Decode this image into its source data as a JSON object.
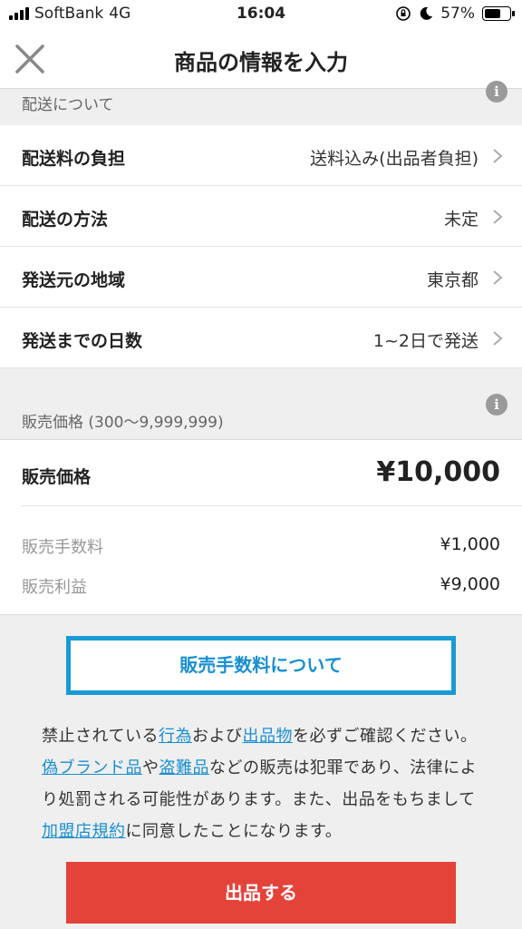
{
  "status_bar": {
    "carrier": "SoftBank",
    "network": "4G",
    "time": "16:04",
    "battery": "57%"
  },
  "header": {
    "title": "商品の情報を入力"
  },
  "shipping": {
    "section_title": "配送について",
    "rows": [
      {
        "label": "配送料の負担",
        "value": "送料込み(出品者負担)"
      },
      {
        "label": "配送の方法",
        "value": "未定"
      },
      {
        "label": "発送元の地域",
        "value": "東京都"
      },
      {
        "label": "発送までの日数",
        "value": "1~2日で発送"
      }
    ]
  },
  "pricing": {
    "section_title": "販売価格 (300〜9,999,999)",
    "price_label": "販売価格",
    "price_value": "¥10,000",
    "fee_label": "販売手数料",
    "fee_value": "¥1,000",
    "profit_label": "販売利益",
    "profit_value": "¥9,000"
  },
  "fee_button": {
    "label": "販売手数料について"
  },
  "notice": {
    "t1": "禁止されている",
    "link1": "行為",
    "t2": "および",
    "link2": "出品物",
    "t3": "を必ずご確認ください。",
    "link3": "偽ブランド品",
    "t4": "や",
    "link4": "盗難品",
    "t5": "などの販売は犯罪であり、法律により処罰される可能性があります。また、出品をもちまして",
    "link5": "加盟店規約",
    "t6": "に同意したことになります。"
  },
  "submit": {
    "label": "出品する"
  },
  "colors": {
    "accent_blue": "#1a9ad6",
    "submit_red": "#e4433a"
  }
}
